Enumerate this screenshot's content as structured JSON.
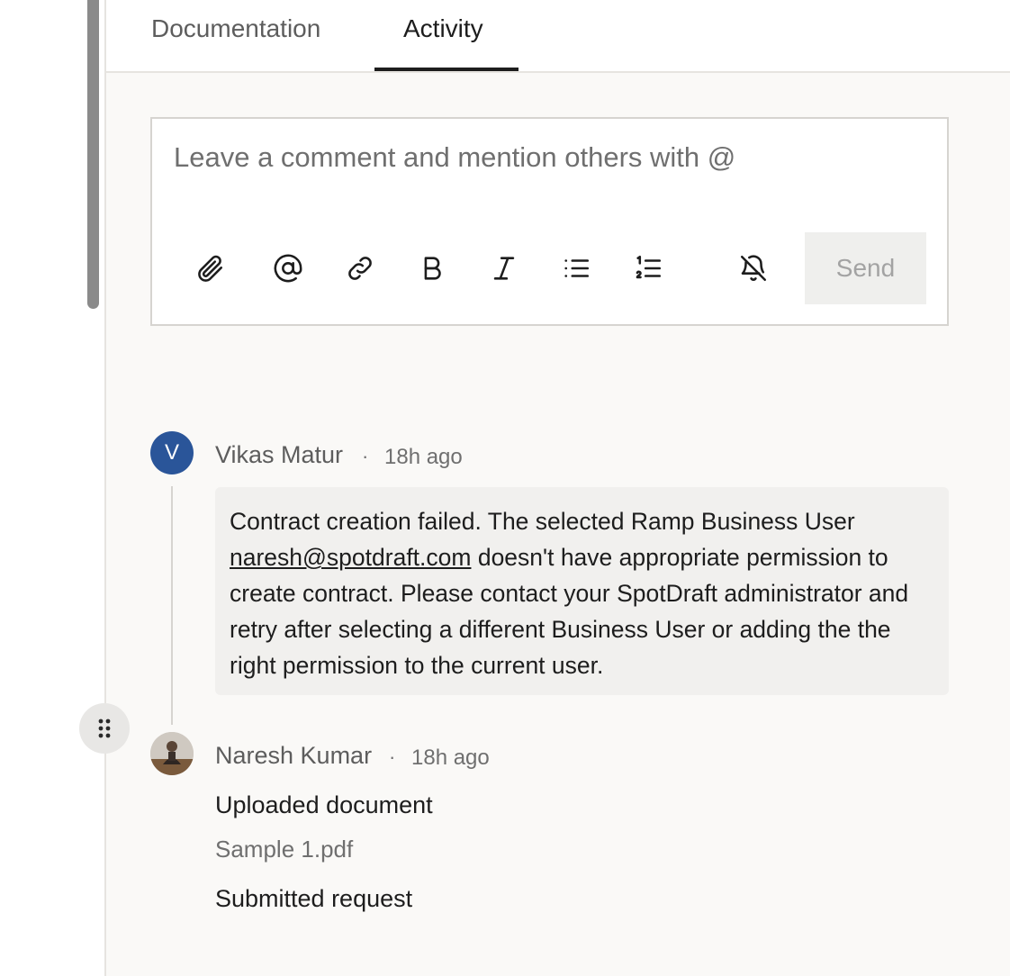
{
  "tabs": [
    {
      "label": "Documentation",
      "active": false
    },
    {
      "label": "Activity",
      "active": true
    }
  ],
  "composer": {
    "placeholder": "Leave a comment and mention others with @",
    "tools": [
      "attachment-icon",
      "mention-icon",
      "link-icon",
      "bold-icon",
      "italic-icon",
      "bullet-list-icon",
      "numbered-list-icon",
      "notifications-off-icon"
    ],
    "send_label": "Send"
  },
  "activity": [
    {
      "author": "Vikas Matur",
      "avatar_initial": "V",
      "avatar_color": "#2a5599",
      "separator": "·",
      "time": "18h ago",
      "comment": {
        "before": "Contract creation failed. The selected Ramp Business User ",
        "email": "naresh@spotdraft.com",
        "after": " doesn't have appropriate permission to create contract. Please contact your SpotDraft administrator and retry after selecting a different Business User or adding the the right permission to the current user."
      }
    },
    {
      "author": "Naresh Kumar",
      "separator": "·",
      "time": "18h ago",
      "events": [
        "Uploaded document",
        "Submitted request"
      ],
      "file_name": "Sample 1.pdf"
    }
  ]
}
